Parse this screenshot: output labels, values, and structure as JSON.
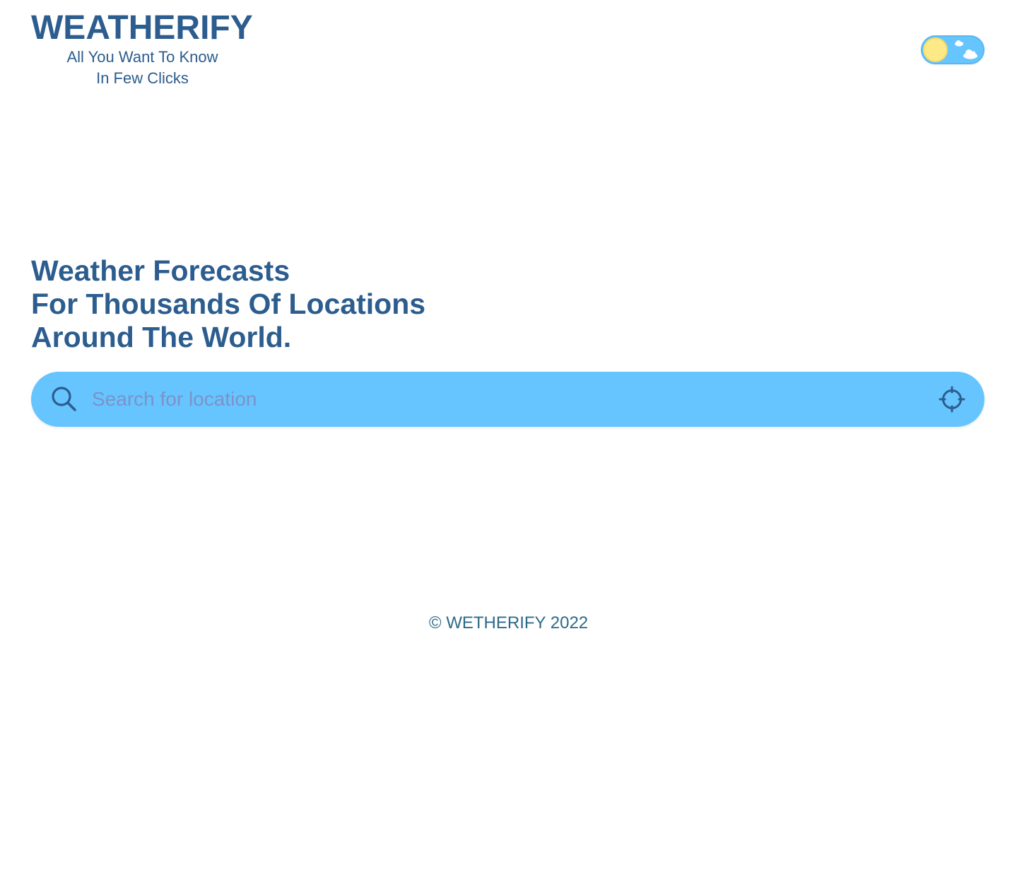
{
  "app": {
    "brand": "WEATHERIFY",
    "tagline_line1": "All You Want To Know",
    "tagline_line2": "In Few Clicks"
  },
  "theme_toggle": {
    "state": "light",
    "knob_icon": "sun-icon",
    "decor_icons": [
      "cloud-icon",
      "cloud-icon"
    ]
  },
  "hero": {
    "line1": "Weather Forecasts",
    "line2": "For Thousands Of Locations",
    "line3": "Around The World."
  },
  "search": {
    "placeholder": "Search for location",
    "value": "",
    "search_icon": "search-icon",
    "locate_icon": "crosshair-icon"
  },
  "footer": {
    "copyright": "© WETHERIFY 2022"
  },
  "colors": {
    "primary": "#2c5d8e",
    "accent": "#66c5ff",
    "sun": "#fde985",
    "placeholder": "#7b93c9",
    "footer_text": "#2c6a8a",
    "background": "#ffffff"
  }
}
